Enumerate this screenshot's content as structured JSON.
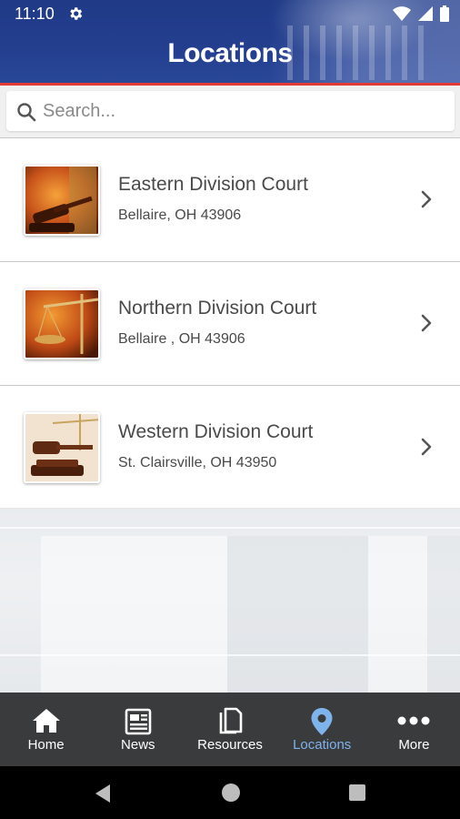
{
  "status": {
    "time": "11:10"
  },
  "header": {
    "title": "Locations"
  },
  "search": {
    "placeholder": "Search..."
  },
  "locations": [
    {
      "name": "Eastern Division Court",
      "address": "Bellaire, OH 43906"
    },
    {
      "name": "Northern Division Court",
      "address": "Bellaire , OH 43906"
    },
    {
      "name": "Western Division Court",
      "address": "St. Clairsville, OH 43950"
    }
  ],
  "tabs": [
    {
      "label": "Home",
      "icon": "home-icon"
    },
    {
      "label": "News",
      "icon": "news-icon"
    },
    {
      "label": "Resources",
      "icon": "resources-icon"
    },
    {
      "label": "Locations",
      "icon": "location-pin-icon",
      "active": true
    },
    {
      "label": "More",
      "icon": "more-icon"
    }
  ],
  "colors": {
    "header": "#243f8f",
    "accent_line": "#e23b35",
    "tabbar": "#3a3b3c",
    "active_tab": "#7fb3ec"
  }
}
